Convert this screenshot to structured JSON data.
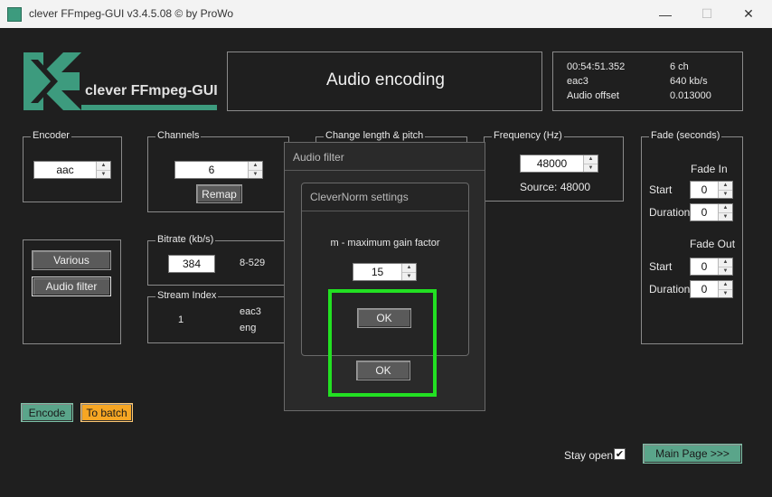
{
  "window": {
    "title": "clever FFmpeg-GUI v3.4.5.08   © by ProWo",
    "minimize": "—",
    "maximize": "☐",
    "close": "✕"
  },
  "logo": {
    "text": "clever FFmpeg-GUI",
    "color": "#3d9b7e"
  },
  "header": {
    "title": "Audio encoding"
  },
  "info": {
    "duration": "00:54:51.352",
    "channels": "6 ch",
    "codec": "eac3",
    "bitrate": "640 kb/s",
    "offset_label": "Audio offset",
    "offset_value": "0.013000"
  },
  "encoder": {
    "label": "Encoder",
    "value": "aac"
  },
  "channels": {
    "label": "Channels",
    "value": "6",
    "remap": "Remap"
  },
  "change_length": {
    "label": "Change length & pitch"
  },
  "frequency": {
    "label": "Frequency (Hz)",
    "value": "48000",
    "source": "Source: 48000"
  },
  "fade": {
    "label": "Fade (seconds)",
    "fade_in": "Fade In",
    "fade_out": "Fade Out",
    "start": "Start",
    "duration": "Duration",
    "in_start": "0",
    "in_duration": "0",
    "out_start": "0",
    "out_duration": "0"
  },
  "buttons": {
    "various": "Various",
    "audio_filter": "Audio filter",
    "encode": "Encode",
    "to_batch": "To batch",
    "main_page": "Main Page >>>"
  },
  "bitrate": {
    "label": "Bitrate (kb/s)",
    "value": "384",
    "range": "8-529"
  },
  "stream": {
    "label": "Stream Index",
    "index": "1",
    "codec": "eac3",
    "lang": "eng"
  },
  "audio_filter_dialog": {
    "title": "Audio filter",
    "ok": "OK"
  },
  "clevernorm_dialog": {
    "title": "CleverNorm settings",
    "param_label": "m - maximum gain factor",
    "value": "15",
    "ok": "OK"
  },
  "stay_open": {
    "label": "Stay open",
    "checked": "✔"
  },
  "colors": {
    "accent_green": "#5aa58a",
    "highlight": "#22e022",
    "orange": "#f6a623"
  }
}
